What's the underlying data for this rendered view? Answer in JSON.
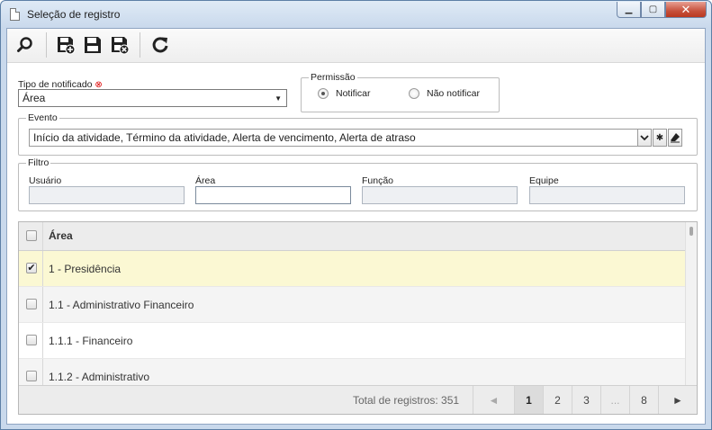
{
  "window": {
    "title": "Seleção de registro"
  },
  "toolbar": {
    "buttons": [
      {
        "icon": "search-icon"
      },
      {
        "icon": "save-new-icon"
      },
      {
        "icon": "save-icon"
      },
      {
        "icon": "save-close-icon"
      },
      {
        "icon": "refresh-icon"
      }
    ]
  },
  "form": {
    "tipo_label": "Tipo de notificado",
    "tipo_value": "Área",
    "permissao": {
      "legend": "Permissão",
      "options": [
        {
          "label": "Notificar",
          "selected": true
        },
        {
          "label": "Não notificar",
          "selected": false
        }
      ]
    },
    "evento": {
      "legend": "Evento",
      "value": "Início da atividade, Término da atividade, Alerta de vencimento, Alerta de atraso"
    },
    "filtro": {
      "legend": "Filtro",
      "fields": [
        {
          "label": "Usuário",
          "value": ""
        },
        {
          "label": "Área",
          "value": ""
        },
        {
          "label": "Função",
          "value": ""
        },
        {
          "label": "Equipe",
          "value": ""
        }
      ]
    }
  },
  "grid": {
    "column": "Área",
    "rows": [
      {
        "label": "1 - Presidência",
        "checked": true
      },
      {
        "label": "1.1 - Administrativo Financeiro",
        "checked": false
      },
      {
        "label": "1.1.1 - Financeiro",
        "checked": false
      },
      {
        "label": "1.1.2 - Administrativo",
        "checked": false
      }
    ],
    "footer": {
      "total": "Total de registros: 351",
      "prev": "◄",
      "pages": [
        "1",
        "2",
        "3",
        "...",
        "8"
      ],
      "current_page": "1",
      "next": "►"
    }
  },
  "colors": {
    "selected_row": "#fbf8d3",
    "close_button": "#c7503c",
    "required_marker": "#dd0000"
  }
}
